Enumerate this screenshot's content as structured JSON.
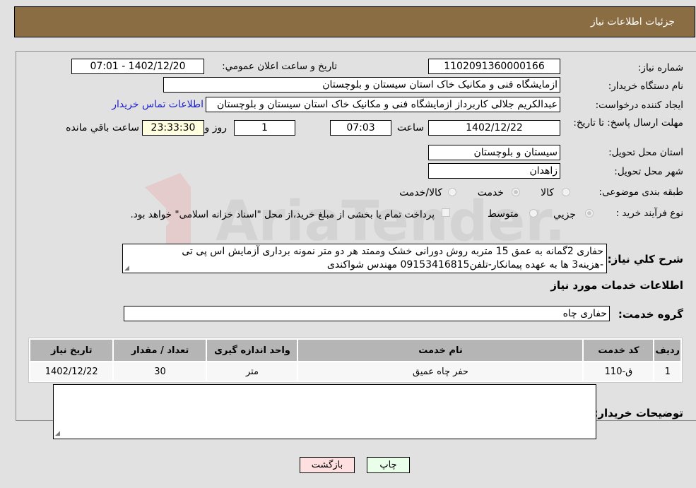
{
  "header": {
    "title": "جزئیات اطلاعات نیاز"
  },
  "form": {
    "need_number": {
      "label": "شماره نیاز:",
      "value": "1102091360000166"
    },
    "announce_datetime": {
      "label": "تاريخ و ساعت اعلان عمومي:",
      "value": "1402/12/20 - 07:01"
    },
    "buyer_org": {
      "label": "نام دستگاه خريدار:",
      "value": "ازمایشگاه فنی و مکانیک خاک استان سیستان و بلوچستان"
    },
    "requester": {
      "label": "ايجاد کننده درخواست:",
      "value": "عبدالکریم جلالی کاربرداز ازمایشگاه فنی و مکانیک خاک استان سیستان و بلوچستان",
      "contact_link": "اطلاعات تماس خريدار"
    },
    "deadline": {
      "label": "مهلت ارسال پاسخ: تا تاريخ:",
      "date": "1402/12/22",
      "time_label": "ساعت",
      "time": "07:03",
      "days": "1",
      "days_label": "روز و",
      "remaining": "23:33:30",
      "remaining_label": "ساعت باقي مانده"
    },
    "province": {
      "label": "استان محل تحويل:",
      "value": "سیستان و بلوچستان"
    },
    "city": {
      "label": "شهر محل تحويل:",
      "value": "زاهدان"
    },
    "category": {
      "label": "طبقه بندی موضوعی:",
      "options": [
        {
          "label": "کالا",
          "checked": false
        },
        {
          "label": "خدمت",
          "checked": true
        },
        {
          "label": "کالا/خدمت",
          "checked": false
        }
      ]
    },
    "process_type": {
      "label": "نوع فرآيند خريد :",
      "options": [
        {
          "label": "جزيي",
          "checked": true
        },
        {
          "label": "متوسط",
          "checked": false
        }
      ],
      "payment_checkbox": "پرداخت تمام يا بخشی از مبلغ خريد،از محل \"اسناد خزانه اسلامی\" خواهد بود."
    },
    "description": {
      "label": "شرح کلي نياز:",
      "line1": "حفاری 2گمانه به عمق 15 متربه روش دورانی خشک وممتد هر دو متر نمونه برداری آزمایش اس پی تی",
      "line2": "-هزینه3 ها به عهده پیمانکار-تلفن09153416815 مهندس شواکندی"
    }
  },
  "services": {
    "section_title": "اطلاعات خدمات مورد نياز",
    "group_label": "گروه خدمت:",
    "group_value": "حفاری چاه",
    "table": {
      "headers": [
        "رديف",
        "کد خدمت",
        "نام خدمت",
        "واحد اندازه گيری",
        "تعداد / مقدار",
        "تاريخ نياز"
      ],
      "rows": [
        [
          "1",
          "ق-110",
          "حفر چاه عمیق",
          "متر",
          "30",
          "1402/12/22"
        ]
      ]
    }
  },
  "buyer_notes": {
    "label": "توضيحات خريدار:",
    "value": ""
  },
  "buttons": {
    "print": "چاپ",
    "back": "بازگشت"
  },
  "watermark": {
    "text": "AriaTender.neT"
  },
  "colors": {
    "header_bg": "#8b6d43",
    "print_btn_bg": "#eaffea",
    "back_btn_bg": "#ffe0e0",
    "link": "#2121c9"
  }
}
